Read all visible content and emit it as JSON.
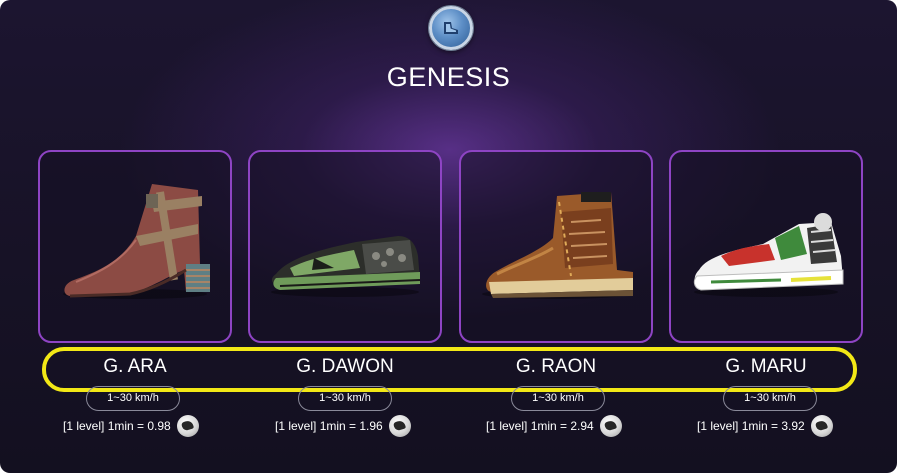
{
  "header": {
    "title": "GENESIS",
    "logo_icon": "shoe-badge-icon"
  },
  "shoes": [
    {
      "name": "G. ARA",
      "speed": "1~30 km/h",
      "rate": "[1 level] 1min = 0.98",
      "icon": "coin-icon",
      "image": "brown-heeled-ankle-boot"
    },
    {
      "name": "G. DAWON",
      "speed": "1~30 km/h",
      "rate": "[1 level] 1min = 1.96",
      "icon": "coin-icon",
      "image": "green-black-slip-on-shoe"
    },
    {
      "name": "G. RAON",
      "speed": "1~30 km/h",
      "rate": "[1 level] 1min = 2.94",
      "icon": "coin-icon",
      "image": "tan-work-boot"
    },
    {
      "name": "G. MARU",
      "speed": "1~30 km/h",
      "rate": "[1 level] 1min = 3.92",
      "icon": "coin-icon",
      "image": "white-red-green-sneaker"
    }
  ],
  "colors": {
    "card_border": "#8e44c4",
    "highlight": "#f2e816",
    "background": "#171226"
  }
}
